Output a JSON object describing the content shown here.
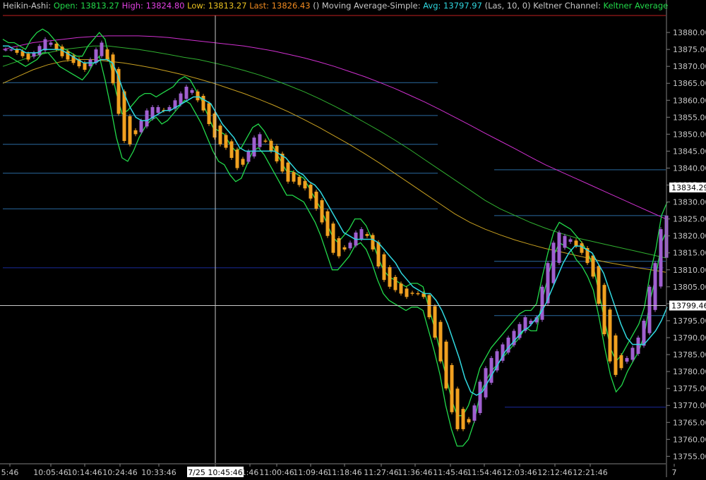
{
  "header": {
    "parts": [
      {
        "text": "Heikin-Ashi:",
        "color": "#c8c8c8"
      },
      {
        "text": "Open: 13813.27",
        "color": "#22d94a"
      },
      {
        "text": "High: 13824.80",
        "color": "#e040e0"
      },
      {
        "text": "Low: 13813.27",
        "color": "#e8c020"
      },
      {
        "text": "Last: 13826.43",
        "color": "#f08a20"
      },
      {
        "text": "()",
        "color": "#c8c8c8"
      },
      {
        "text": "Moving Average-Simple:",
        "color": "#c8c8c8"
      },
      {
        "text": "Avg: 13797.97",
        "color": "#30d8e0"
      },
      {
        "text": "(Las, 10, 0)",
        "color": "#c8c8c8"
      },
      {
        "text": "Keltner Channel:",
        "color": "#c8c8c8"
      },
      {
        "text": "Keltner Average",
        "color": "#22d94a"
      }
    ]
  },
  "colors": {
    "background": "#000000",
    "axis_text": "#c8c8c8",
    "grid_blue": "#2a6aa0",
    "grid_navy": "#1a2a9a",
    "candle_up": "#a060d0",
    "candle_down": "#f0a020",
    "sma": "#30d8e0",
    "keltner": "#22d94a",
    "upper_ma": "#d030d0",
    "mid_ma": "#30b030",
    "low_ma": "#c8a020",
    "crosshair": "#c8c8c8",
    "top_line": "#c02020"
  },
  "chart_data": {
    "type": "candlestick",
    "x_tick_labels": [
      "5:46",
      "10:05:46",
      "10:14:46",
      "10:24:46",
      "10:33:46",
      "7/25 10:45:46",
      "1:46",
      "11:00:46",
      "11:09:46",
      "11:18:46",
      "11:27:46",
      "11:36:46",
      "11:45:46",
      "11:54:46",
      "12:03:46",
      "12:12:46",
      "12:21:46",
      "7"
    ],
    "y_range": [
      13753,
      13885
    ],
    "y_ticks": [
      13755,
      13760,
      13765,
      13770,
      13775,
      13780,
      13785,
      13790,
      13795,
      13800,
      13805,
      13810,
      13815,
      13820,
      13825,
      13830,
      13835,
      13840,
      13845,
      13850,
      13855,
      13860,
      13865,
      13870,
      13875,
      13880
    ],
    "y_tick_labels": [
      "13755.00",
      "13760.00",
      "13765.00",
      "13770.00",
      "13775.00",
      "13780.00",
      "13785.00",
      "13790.00",
      "13795.00",
      "13800.00",
      "13805.00",
      "13810.00",
      "13815.00",
      "13820.00",
      "13825.00",
      "13830.00",
      "13835.00",
      "13840.00",
      "13845.00",
      "13850.00",
      "13855.00",
      "13860.00",
      "13865.00",
      "13870.00",
      "13875.00",
      "13880.00"
    ],
    "price_label_top": "13834.29",
    "price_label_cross": "13799.46",
    "price_value_top": 13834.29,
    "price_value_cross": 13799.46,
    "bar_count": 140,
    "close_series": [
      13875,
      13875,
      13874,
      13873,
      13872,
      13874,
      13876,
      13878,
      13877,
      13875,
      13873,
      13872,
      13871,
      13870,
      13869,
      13872,
      13875,
      13877,
      13872,
      13865,
      13856,
      13848,
      13847,
      13850,
      13854,
      13857,
      13858,
      13858,
      13857,
      13858,
      13860,
      13862,
      13864,
      13863,
      13860,
      13857,
      13853,
      13849,
      13847,
      13846,
      13843,
      13840,
      13841,
      13845,
      13849,
      13850,
      13848,
      13845,
      13842,
      13839,
      13836,
      13836,
      13835,
      13834,
      13831,
      13828,
      13824,
      13820,
      13815,
      13814,
      13816,
      13818,
      13821,
      13822,
      13820,
      13816,
      13811,
      13807,
      13805,
      13804,
      13803,
      13802,
      13803,
      13803,
      13802,
      13796,
      13790,
      13783,
      13775,
      13768,
      13763,
      13763,
      13765,
      13770,
      13777,
      13781,
      13784,
      13786,
      13788,
      13790,
      13792,
      13794,
      13796,
      13795,
      13796,
      13805,
      13812,
      13818,
      13821,
      13820,
      13819,
      13817,
      13815,
      13812,
      13808,
      13800,
      13791,
      13783,
      13779,
      13781,
      13784,
      13787,
      13790,
      13795,
      13805,
      13812,
      13822,
      13826
    ],
    "sma_series": [
      13876,
      13876,
      13875,
      13875,
      13874,
      13874,
      13874,
      13875,
      13875,
      13875,
      13875,
      13874,
      13873,
      13872,
      13871,
      13871,
      13871,
      13872,
      13872,
      13871,
      13867,
      13862,
      13858,
      13855,
      13854,
      13854,
      13855,
      13856,
      13857,
      13857,
      13858,
      13859,
      13860,
      13861,
      13861,
      13860,
      13859,
      13856,
      13853,
      13851,
      13849,
      13846,
      13845,
      13845,
      13845,
      13845,
      13845,
      13845,
      13844,
      13843,
      13841,
      13839,
      13838,
      13836,
      13835,
      13833,
      13830,
      13827,
      13824,
      13821,
      13820,
      13819,
      13819,
      13819,
      13819,
      13818,
      13816,
      13814,
      13812,
      13809,
      13807,
      13805,
      13804,
      13803,
      13803,
      13801,
      13798,
      13794,
      13789,
      13784,
      13778,
      13774,
      13773,
      13774,
      13777,
      13780,
      13783,
      13786,
      13788,
      13790,
      13792,
      13793,
      13795,
      13797,
      13800,
      13804,
      13808,
      13812,
      13815,
      13817,
      13817,
      13816,
      13815,
      13812,
      13809,
      13804,
      13799,
      13794,
      13790,
      13788,
      13788,
      13788,
      13790,
      13792,
      13795,
      13799
    ],
    "keltner_upper_series": [
      13878,
      13877,
      13877,
      13876,
      13875,
      13878,
      13880,
      13881,
      13880,
      13878,
      13876,
      13875,
      13874,
      13873,
      13873,
      13876,
      13878,
      13880,
      13878,
      13870,
      13862,
      13856,
      13857,
      13859,
      13861,
      13862,
      13862,
      13861,
      13862,
      13863,
      13864,
      13866,
      13867,
      13866,
      13863,
      13860,
      13856,
      13852,
      13851,
      13850,
      13847,
      13845,
      13846,
      13849,
      13852,
      13853,
      13851,
      13848,
      13845,
      13842,
      13839,
      13839,
      13838,
      13837,
      13834,
      13831,
      13828,
      13824,
      13820,
      13818,
      13820,
      13822,
      13825,
      13825,
      13823,
      13819,
      13814,
      13810,
      13808,
      13807,
      13806,
      13805,
      13806,
      13806,
      13805,
      13799,
      13793,
      13786,
      13779,
      13772,
      13767,
      13767,
      13770,
      13775,
      13781,
      13784,
      13787,
      13789,
      13791,
      13793,
      13795,
      13797,
      13798,
      13798,
      13800,
      13808,
      13815,
      13821,
      13824,
      13823,
      13822,
      13820,
      13818,
      13815,
      13811,
      13803,
      13795,
      13787,
      13783,
      13785,
      13788,
      13791,
      13794,
      13799,
      13809,
      13816,
      13826,
      13830
    ],
    "keltner_lower_series": [
      13873,
      13873,
      13872,
      13871,
      13870,
      13871,
      13872,
      13874,
      13874,
      13872,
      13870,
      13869,
      13868,
      13867,
      13866,
      13868,
      13871,
      13873,
      13866,
      13858,
      13849,
      13843,
      13842,
      13845,
      13849,
      13852,
      13854,
      13855,
      13853,
      13854,
      13856,
      13858,
      13860,
      13859,
      13856,
      13853,
      13849,
      13845,
      13842,
      13841,
      13838,
      13836,
      13837,
      13841,
      13845,
      13846,
      13844,
      13841,
      13838,
      13835,
      13832,
      13832,
      13831,
      13830,
      13827,
      13824,
      13820,
      13815,
      13810,
      13810,
      13812,
      13814,
      13817,
      13818,
      13816,
      13812,
      13807,
      13803,
      13801,
      13800,
      13799,
      13798,
      13799,
      13799,
      13798,
      13792,
      13786,
      13779,
      13770,
      13763,
      13758,
      13758,
      13760,
      13765,
      13773,
      13777,
      13780,
      13782,
      13784,
      13786,
      13788,
      13790,
      13793,
      13792,
      13792,
      13801,
      13808,
      13814,
      13818,
      13817,
      13816,
      13813,
      13811,
      13808,
      13804,
      13796,
      13787,
      13779,
      13774,
      13776,
      13780,
      13783,
      13786,
      13791,
      13801,
      13808,
      13818,
      13822
    ],
    "ma_magenta_series": [
      13875,
      13876,
      13877,
      13877.5,
      13878,
      13878.5,
      13878.8,
      13879,
      13879,
      13879,
      13878.8,
      13878.5,
      13878,
      13877.5,
      13877,
      13876.5,
      13876,
      13875.3,
      13874.5,
      13873.5,
      13872.5,
      13871.3,
      13870,
      13868.5,
      13867,
      13865.3,
      13863.5,
      13861.5,
      13859.5,
      13857.3,
      13855,
      13852.7,
      13850.3,
      13848,
      13845.7,
      13843.3,
      13841,
      13839,
      13837,
      13835,
      13833,
      13831,
      13829,
      13827,
      13825
    ],
    "ma_green_series": [
      13870,
      13871.5,
      13873,
      13874,
      13875,
      13875.5,
      13876,
      13876,
      13875.5,
      13875,
      13874.3,
      13873.5,
      13872.7,
      13872,
      13871,
      13870,
      13868.8,
      13867.5,
      13866,
      13864.3,
      13862.5,
      13860.5,
      13858.3,
      13856,
      13853.5,
      13851,
      13848.3,
      13845.5,
      13842.5,
      13839.5,
      13836.5,
      13833.5,
      13830.5,
      13828,
      13826,
      13824,
      13822.3,
      13820.8,
      13819.5,
      13818.5,
      13817.5,
      13816.5,
      13815.5,
      13814.5,
      13813.5
    ],
    "ma_gold_series": [
      13865,
      13867,
      13869,
      13870.5,
      13871.5,
      13872,
      13872,
      13871.5,
      13871,
      13870.3,
      13869.5,
      13868.5,
      13867.5,
      13866.3,
      13865,
      13863.5,
      13862,
      13860.3,
      13858.5,
      13856.5,
      13854.3,
      13852,
      13849.5,
      13847,
      13844.3,
      13841.5,
      13838.5,
      13835.5,
      13832.5,
      13829.5,
      13826.5,
      13824,
      13822,
      13820.3,
      13818.8,
      13817.5,
      13816.3,
      13815.3,
      13814.3,
      13813.3,
      13812.3,
      13811.5,
      13810.7,
      13810,
      13809.3
    ],
    "horizontal_levels": [
      {
        "value": 13865.2,
        "color": "grid_blue",
        "end_to_axis": true
      },
      {
        "value": 13855.5,
        "color": "grid_blue",
        "end_to_axis": true
      },
      {
        "value": 13847.0,
        "color": "grid_blue",
        "end_to_axis": true
      },
      {
        "value": 13838.5,
        "color": "grid_blue",
        "end_to_axis": true
      },
      {
        "value": 13828.0,
        "color": "grid_blue",
        "end_to_axis": true
      },
      {
        "value": 13810.6,
        "color": "grid_navy",
        "end_to_axis": true
      },
      {
        "value": 13839.5,
        "color": "grid_blue",
        "end_to_axis": true
      },
      {
        "value": 13826.0,
        "color": "grid_blue",
        "end_to_axis": true
      },
      {
        "value": 13812.5,
        "color": "grid_blue",
        "end_to_axis": true
      },
      {
        "value": 13796.5,
        "color": "grid_blue",
        "end_to_axis": true
      },
      {
        "value": 13769.5,
        "color": "grid_navy",
        "end_to_axis": true
      }
    ]
  }
}
